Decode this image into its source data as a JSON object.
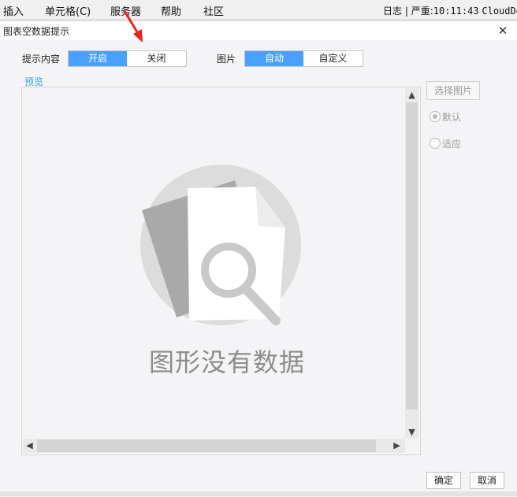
{
  "menubar": {
    "items": [
      {
        "label": "插入"
      },
      {
        "label": "单元格(C)"
      },
      {
        "label": "服务器"
      },
      {
        "label": "帮助"
      },
      {
        "label": "社区"
      }
    ],
    "log": "日志",
    "severity": "严重:",
    "time": "10:11:43",
    "logger": "CloudDe"
  },
  "dialog": {
    "title": "图表空数据提示",
    "hint_label": "提示内容",
    "hint_on": "开启",
    "hint_off": "关闭",
    "image_label": "图片",
    "image_auto": "自动",
    "image_custom": "自定义",
    "preview_label": "预览",
    "nodata_text": "图形没有数据",
    "pick_image": "选择图片",
    "radio_default": "默认",
    "radio_fit": "适应",
    "ok": "确定",
    "cancel": "取消"
  },
  "colors": {
    "accent": "#4aa0ff",
    "preview_label": "#3aa3d9",
    "arrow": "#e5261c"
  },
  "icons": [
    "close-icon",
    "scroll-up-icon",
    "scroll-down-icon",
    "scroll-left-icon",
    "scroll-right-icon",
    "arrow-annotation",
    "no-data-illustration"
  ]
}
